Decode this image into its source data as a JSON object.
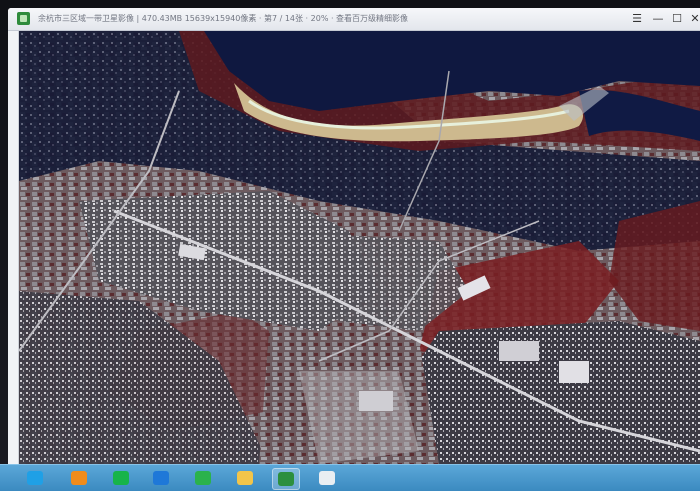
{
  "window": {
    "title": "余杭市三区域一带卫星影像 | 470.43MB  15639x15940像素  · 第7 / 14张 · 20% · 查看百万级精细影像"
  },
  "controls": {
    "menu_icon": "☰",
    "minimize_icon": "—",
    "maximize_icon": "☐",
    "close_icon": "✕"
  },
  "taskbar": {
    "apps": [
      {
        "name": "qq-icon",
        "color": "#1fa0e6"
      },
      {
        "name": "app-icon-orange",
        "color": "#f08c1c"
      },
      {
        "name": "iqiyi-icon",
        "color": "#17b44a"
      },
      {
        "name": "ie-browser-icon",
        "color": "#1e78d8"
      },
      {
        "name": "wechat-icon",
        "color": "#2bb24c"
      },
      {
        "name": "folder-icon",
        "color": "#f2c54a"
      },
      {
        "name": "image-viewer-icon",
        "color": "#2c8f3e"
      },
      {
        "name": "browser-icon",
        "color": "#e9eef2"
      }
    ]
  },
  "colors": {
    "river": "#0f1840",
    "sandbank": "#cdb98e",
    "vegetation_red": "#7a1f1f",
    "urban": "#9c9ba0"
  }
}
